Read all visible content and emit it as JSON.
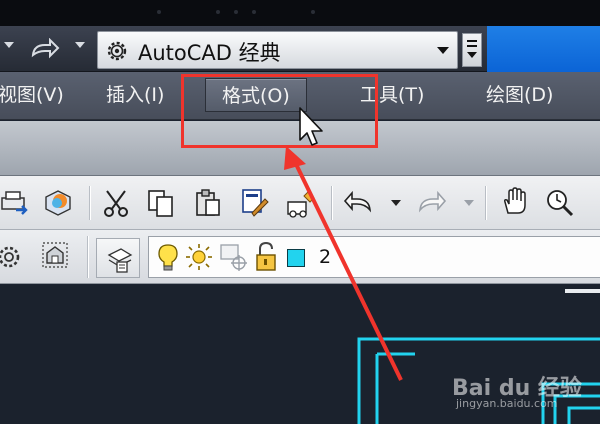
{
  "quick_access": {
    "redo_icon": "redo-arrow-icon",
    "workspace_label": "AutoCAD 经典",
    "workspace_icon": "gear-icon"
  },
  "menubar": {
    "items": [
      {
        "label": "视图(V)"
      },
      {
        "label": "插入(I)"
      },
      {
        "label": "格式(O)",
        "active": true
      },
      {
        "label": "工具(T)"
      },
      {
        "label": "绘图(D)"
      }
    ]
  },
  "toolbar_standard": {
    "icons": [
      "plot-icon",
      "3d-dwf-icon",
      "cut-icon",
      "copy-icon",
      "paste-icon",
      "match-properties-icon",
      "block-editor-icon",
      "undo-icon",
      "redo-icon",
      "pan-icon",
      "zoom-realtime-icon"
    ]
  },
  "toolbar_layers": {
    "icons": [
      "workspace-settings-icon",
      "layer-states-icon",
      "layer-properties-icon",
      "lightbulb-icon",
      "sun-icon",
      "freeze-viewport-icon",
      "unlock-icon"
    ],
    "current_layer_color": "#22d3ee",
    "current_layer": "2"
  },
  "watermark": {
    "brand": "Bai du 经验",
    "url": "jingyan.baidu.com"
  },
  "colors": {
    "annotation_red": "#f0342c",
    "title_blue": "#0b64d6",
    "drawing_cyan": "#22d3ee"
  }
}
